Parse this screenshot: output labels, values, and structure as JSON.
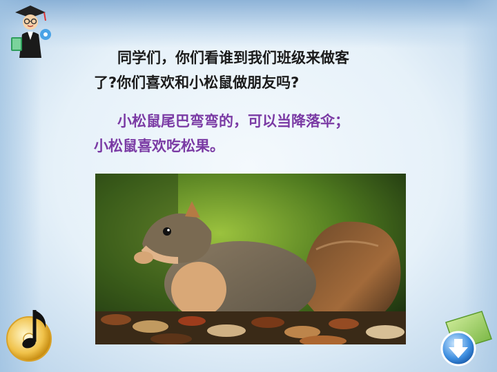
{
  "slide": {
    "question_line1": "同学们，你们看谁到我们班级来做客",
    "question_line2": "了?你们喜欢和小松鼠做朋友吗?",
    "desc_line1": "小松鼠尾巴弯弯的，可以当降落伞；",
    "desc_line2": "小松鼠喜欢吃松果。"
  },
  "icons": {
    "teacher": "teacher-icon",
    "music": "music-note-icon",
    "next": "down-arrow-icon"
  },
  "colors": {
    "question_text": "#1b1b1b",
    "description_text": "#7a3aa4",
    "background": "#e6f1f9"
  }
}
